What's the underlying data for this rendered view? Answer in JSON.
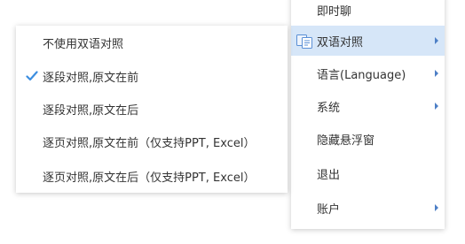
{
  "main_menu": {
    "items": [
      {
        "label": "即时聊",
        "has_submenu": false
      },
      {
        "label": "双语对照",
        "has_submenu": true,
        "active": true,
        "icon": "bilingual-icon"
      },
      {
        "label": "语言(Language)",
        "has_submenu": true
      },
      {
        "label": "系统",
        "has_submenu": true
      },
      {
        "label": "隐藏悬浮窗",
        "has_submenu": false
      },
      {
        "label": "退出",
        "has_submenu": false
      },
      {
        "label": "账户",
        "has_submenu": true
      }
    ]
  },
  "sub_menu": {
    "items": [
      {
        "label": "不使用双语对照",
        "checked": false
      },
      {
        "label": "逐段对照,原文在前",
        "checked": true
      },
      {
        "label": "逐段对照,原文在后",
        "checked": false
      },
      {
        "label": "逐页对照,原文在前（仅支持PPT, Excel）",
        "checked": false
      },
      {
        "label": "逐页对照,原文在后（仅支持PPT, Excel）",
        "checked": false
      }
    ]
  },
  "colors": {
    "active_bg": "#d6e6f8",
    "accent": "#4d7fc6",
    "check": "#3c8ee0"
  }
}
